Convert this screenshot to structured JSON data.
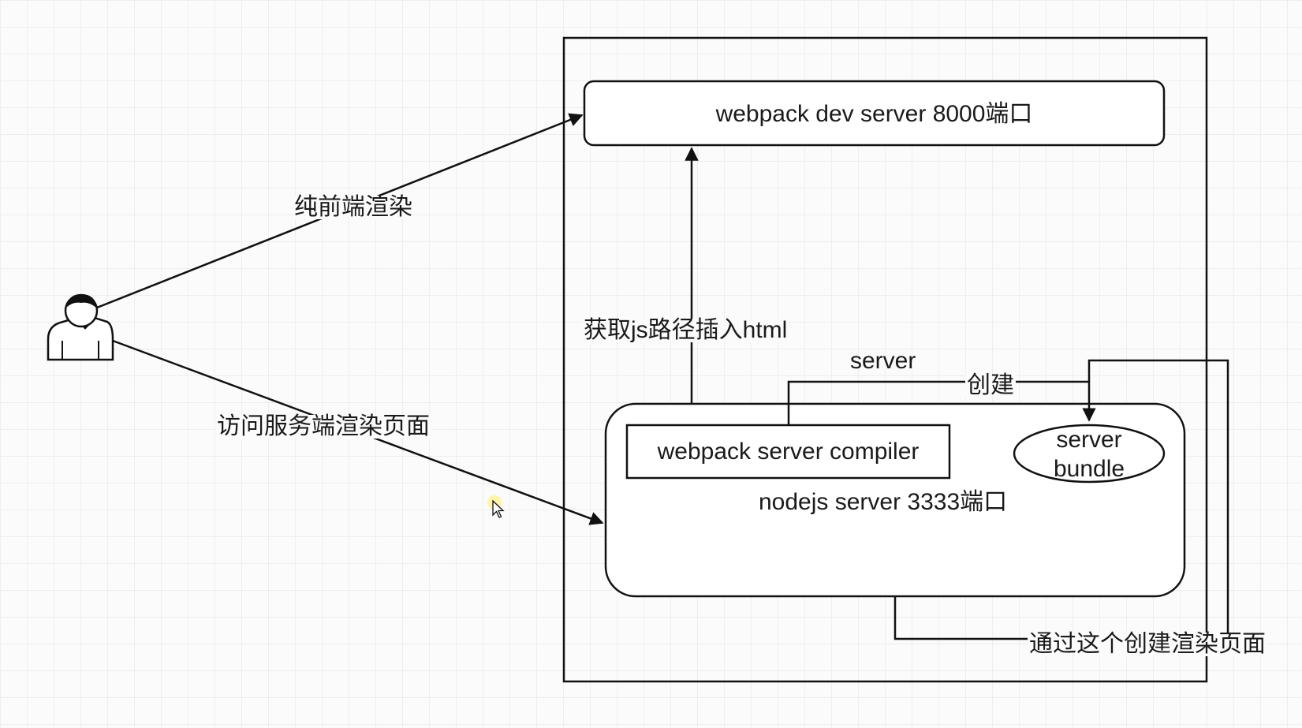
{
  "labels": {
    "webpack_dev_server": "webpack dev server  8000端口",
    "pure_frontend_render": "纯前端渲染",
    "get_js_path": "获取js路径插入html",
    "server_create_top": "server",
    "server_create_bottom": "创建",
    "visit_ssr_page": "访问服务端渲染页面",
    "webpack_server_compiler": "webpack server compiler",
    "server_bundle_line1": "server",
    "server_bundle_line2": "bundle",
    "nodejs_server": "nodejs server  3333端口",
    "create_render_page": "通过这个创建渲染页面"
  },
  "icons": {
    "user": "user-icon",
    "cursor": "mouse-cursor-icon"
  },
  "colors": {
    "stroke": "#111111",
    "background": "#fbfbfb",
    "grid": "#eeeeee",
    "cursor_highlight": "#fff3a0"
  }
}
